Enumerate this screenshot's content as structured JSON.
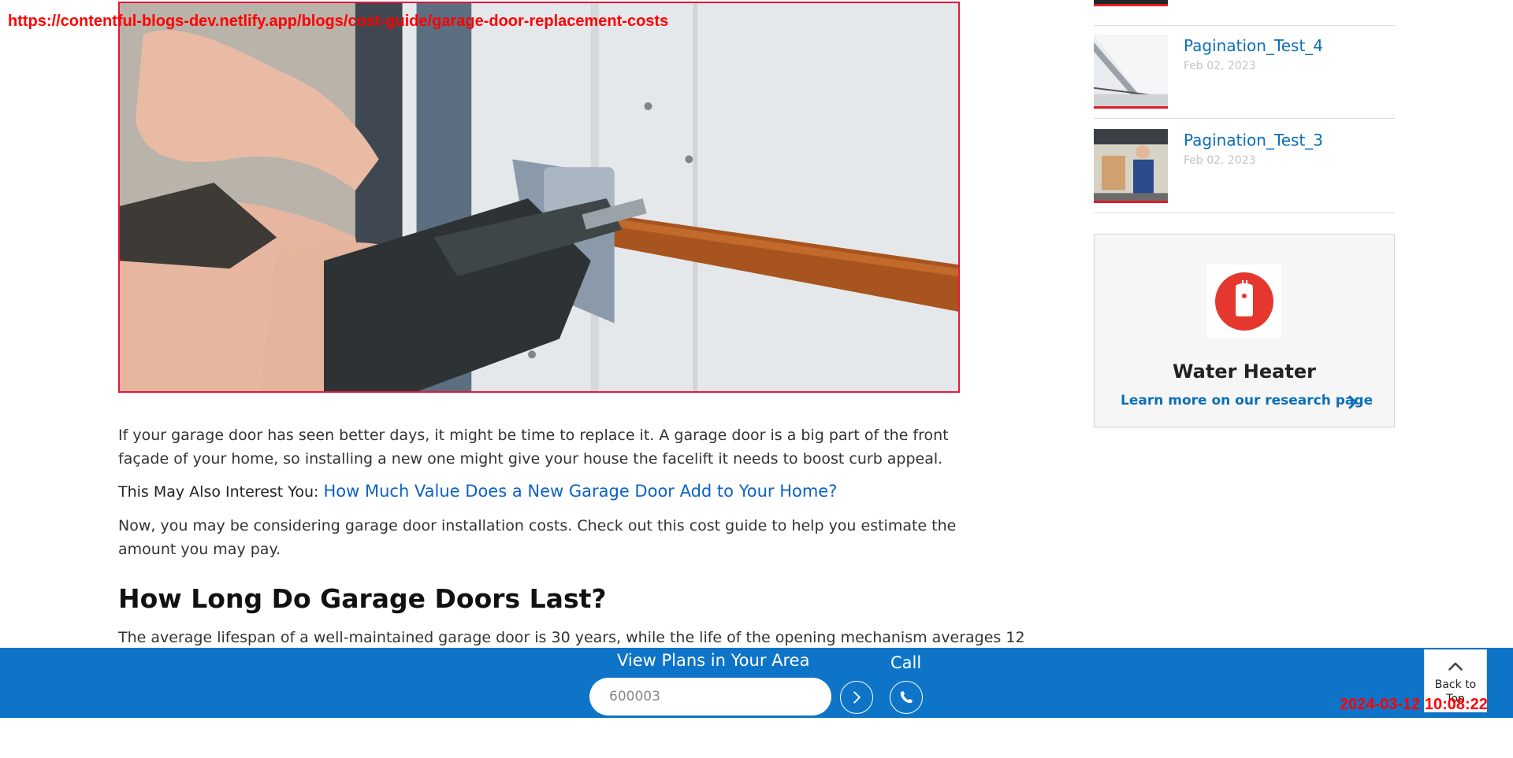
{
  "overlay": {
    "url": "https://contentful-blogs-dev.netlify.app/blogs/cost-guide/garage-door-replacement-costs",
    "timestamp": "2024-03-12 10:08:22"
  },
  "hero": {
    "icon": "garage-door-installation-photo"
  },
  "article": {
    "p1": "If your garage door has seen better days, it might be time to replace it. A garage door is a big part of the front façade of your home, so installing a new one might give your house the facelift it needs to boost curb appeal.",
    "interest_label": "This May Also Interest You:",
    "interest_link": "How Much Value Does a New Garage Door Add to Your Home?",
    "p2": "Now, you may be considering garage door installation costs. Check out this cost guide to help you estimate the amount you may pay.",
    "heading": "How Long Do Garage Doors Last?",
    "p3": "The average lifespan of a well-maintained garage door is 30 years, while the life of the opening mechanism averages 12"
  },
  "sidebar": {
    "posts": [
      {
        "title": "Pagination_Test_4",
        "date": "Feb 02, 2023"
      },
      {
        "title": "Pagination_Test_3",
        "date": "Feb 02, 2023"
      }
    ],
    "card": {
      "icon": "water-heater-icon",
      "title": "Water Heater",
      "link": "Learn more on our research page"
    }
  },
  "bottom_bar": {
    "plans_title": "View Plans in Your Area",
    "zip_value": "600003",
    "call_label": "Call",
    "back_to_top": "Back to Top"
  },
  "colors": {
    "brand_blue": "#0e74c8",
    "link_blue": "#0b6fb8",
    "accent_red": "#e31b23"
  }
}
